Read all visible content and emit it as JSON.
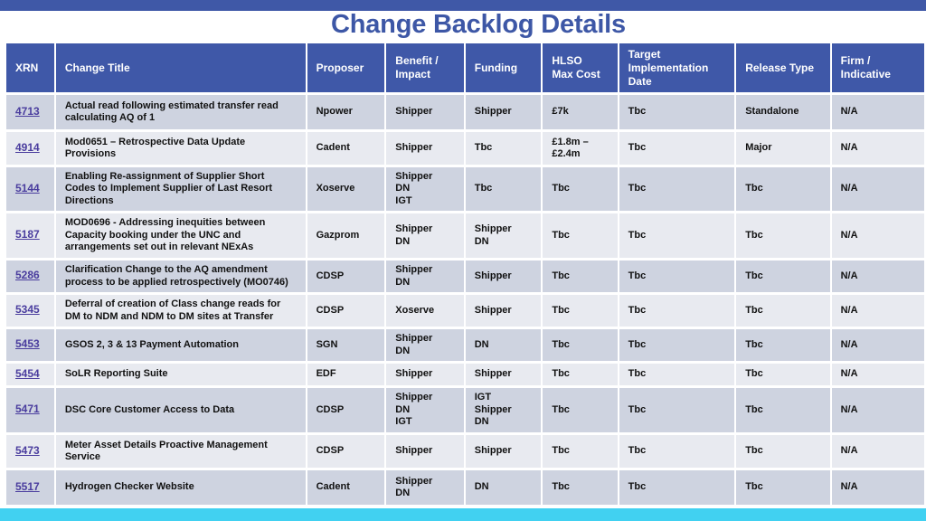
{
  "title": "Change Backlog Details",
  "colors": {
    "header_bg": "#3f58a8",
    "title": "#3d57a6",
    "bottom_bar": "#41d1f1",
    "row_odd": "#ced3e0",
    "row_even": "#e8eaf0",
    "link": "#4a3d9e"
  },
  "columns": [
    [
      "XRN"
    ],
    [
      "Change Title"
    ],
    [
      "Proposer"
    ],
    [
      "Benefit /",
      "Impact"
    ],
    [
      "Funding"
    ],
    [
      "HLSO",
      "Max Cost"
    ],
    [
      "Target",
      "Implementation",
      "Date"
    ],
    [
      "Release Type"
    ],
    [
      "Firm /",
      "Indicative"
    ]
  ],
  "rows": [
    {
      "xrn": "4713",
      "title": [
        "Actual read following estimated transfer read",
        "calculating AQ of 1"
      ],
      "proposer": "Npower",
      "benefit": [
        "Shipper"
      ],
      "funding": [
        "Shipper"
      ],
      "cost": [
        "£7k"
      ],
      "target": "Tbc",
      "release": "Standalone",
      "firm": "N/A"
    },
    {
      "xrn": "4914",
      "title": [
        "Mod0651 – Retrospective Data Update",
        "Provisions"
      ],
      "proposer": "Cadent",
      "benefit": [
        "Shipper"
      ],
      "funding": [
        "Tbc"
      ],
      "cost": [
        "£1.8m –",
        "£2.4m"
      ],
      "target": "Tbc",
      "release": "Major",
      "firm": "N/A"
    },
    {
      "xrn": "5144",
      "title": [
        "Enabling Re-assignment of Supplier Short",
        "Codes to Implement Supplier of Last Resort",
        "Directions"
      ],
      "proposer": "Xoserve",
      "benefit": [
        "Shipper",
        "DN",
        "IGT"
      ],
      "funding": [
        "Tbc"
      ],
      "cost": [
        "Tbc"
      ],
      "target": "Tbc",
      "release": "Tbc",
      "firm": "N/A"
    },
    {
      "xrn": "5187",
      "title": [
        "MOD0696 - Addressing inequities between",
        "Capacity booking under the UNC and",
        "arrangements set out in relevant NExAs"
      ],
      "proposer": "Gazprom",
      "benefit": [
        "Shipper",
        "DN"
      ],
      "funding": [
        "Shipper",
        "DN"
      ],
      "cost": [
        "Tbc"
      ],
      "target": "Tbc",
      "release": "Tbc",
      "firm": "N/A"
    },
    {
      "xrn": "5286",
      "title": [
        "Clarification Change to the AQ amendment",
        "process to be applied retrospectively (MO0746)"
      ],
      "proposer": "CDSP",
      "benefit": [
        "Shipper",
        "DN"
      ],
      "funding": [
        "Shipper"
      ],
      "cost": [
        "Tbc"
      ],
      "target": "Tbc",
      "release": "Tbc",
      "firm": "N/A"
    },
    {
      "xrn": "5345",
      "title": [
        "Deferral of creation of Class change reads for",
        "DM to NDM and NDM to DM sites at Transfer"
      ],
      "proposer": "CDSP",
      "benefit": [
        "Xoserve"
      ],
      "funding": [
        "Shipper"
      ],
      "cost": [
        "Tbc"
      ],
      "target": "Tbc",
      "release": "Tbc",
      "firm": "N/A"
    },
    {
      "xrn": "5453",
      "title": [
        "GSOS 2, 3 & 13 Payment Automation"
      ],
      "proposer": "SGN",
      "benefit": [
        "Shipper",
        "DN"
      ],
      "funding": [
        "DN"
      ],
      "cost": [
        "Tbc"
      ],
      "target": "Tbc",
      "release": "Tbc",
      "firm": "N/A"
    },
    {
      "xrn": "5454",
      "title": [
        "SoLR Reporting Suite"
      ],
      "proposer": "EDF",
      "benefit": [
        "Shipper"
      ],
      "funding": [
        "Shipper"
      ],
      "cost": [
        "Tbc"
      ],
      "target": "Tbc",
      "release": "Tbc",
      "firm": "N/A"
    },
    {
      "xrn": "5471",
      "title": [
        "DSC Core Customer Access to Data"
      ],
      "proposer": "CDSP",
      "benefit": [
        "Shipper",
        "DN",
        "IGT"
      ],
      "funding": [
        "IGT",
        "Shipper",
        "DN"
      ],
      "cost": [
        "Tbc"
      ],
      "target": "Tbc",
      "release": "Tbc",
      "firm": "N/A"
    },
    {
      "xrn": "5473",
      "title": [
        "Meter Asset Details Proactive Management",
        "Service"
      ],
      "proposer": "CDSP",
      "benefit": [
        "Shipper"
      ],
      "funding": [
        "Shipper"
      ],
      "cost": [
        "Tbc"
      ],
      "target": "Tbc",
      "release": "Tbc",
      "firm": "N/A"
    },
    {
      "xrn": "5517",
      "title": [
        "Hydrogen Checker Website"
      ],
      "proposer": "Cadent",
      "benefit": [
        "Shipper",
        "DN"
      ],
      "funding": [
        "DN"
      ],
      "cost": [
        "Tbc"
      ],
      "target": "Tbc",
      "release": "Tbc",
      "firm": "N/A"
    }
  ]
}
